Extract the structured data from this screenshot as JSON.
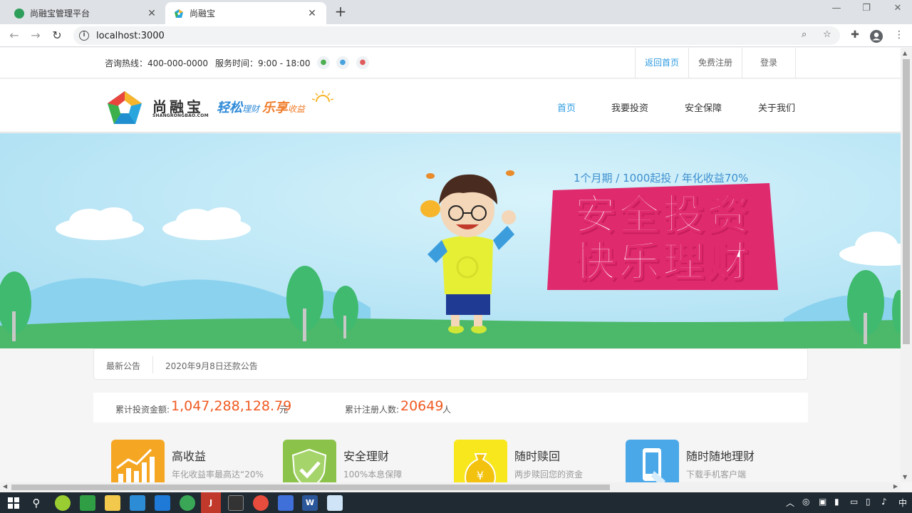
{
  "browser": {
    "tabs": [
      {
        "title": "尚融宝管理平台",
        "active": false
      },
      {
        "title": "尚融宝",
        "active": true
      }
    ],
    "url": "localhost:3000",
    "new_tab": "+",
    "close_glyph": "✕",
    "icons": [
      "back-icon",
      "forward-icon",
      "reload-icon",
      "info-icon",
      "zoom-icon",
      "bookmark-star-icon",
      "extensions-icon",
      "profile-icon",
      "menu-icon"
    ]
  },
  "topbar": {
    "hotline": "咨询热线：400-000-0000",
    "service_time": "服务时间：9:00 - 18:00",
    "social_icons": [
      "wechat-icon",
      "qq-icon",
      "weibo-icon"
    ],
    "links": [
      "返回首页",
      "免费注册",
      "登录"
    ]
  },
  "header": {
    "logo_name": "尚融宝",
    "logo_sub": "SHANGRONGBAO.COM",
    "slogan": [
      "轻松",
      "理财",
      "乐享",
      "收益"
    ],
    "nav": [
      "首页",
      "我要投资",
      "安全保障",
      "关于我们"
    ]
  },
  "banner": {
    "tagline": "1个月期 / 1000起投 / 年化收益70%",
    "headline_1": "安全投资",
    "headline_2": "快乐理财"
  },
  "notice": {
    "label": "最新公告",
    "text": "2020年9月8日还款公告"
  },
  "stats": {
    "invest_label": "累计投资金额:",
    "invest_value": "1,047,288,128.79",
    "invest_unit": "元",
    "users_label": "累计注册人数:",
    "users_value": "20649",
    "users_unit": "人"
  },
  "features": [
    {
      "title": "高收益",
      "desc": "年化收益率最高达“20%",
      "color": "#f5a623",
      "icon": "chart-bars-icon"
    },
    {
      "title": "安全理财",
      "desc": "100%本息保障",
      "color": "#8bc34a",
      "icon": "shield-check-icon"
    },
    {
      "title": "随时赎回",
      "desc": "两步赎回您的资金",
      "color": "#f8e71c",
      "icon": "money-bag-icon"
    },
    {
      "title": "随时随地理财",
      "desc": "下载手机客户端",
      "color": "#4aa8e8",
      "icon": "mobile-phone-icon"
    }
  ],
  "taskbar": {
    "ime": "中"
  },
  "colors": {
    "accent": "#2e9ce0",
    "number": "#f05a22",
    "banner_sky": "#b5e6f5",
    "banner_text": "#e02a6e"
  }
}
